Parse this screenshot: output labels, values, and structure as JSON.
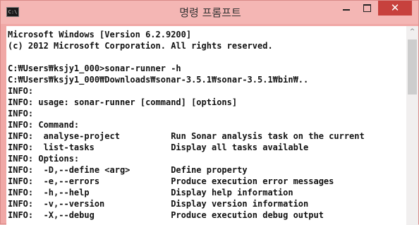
{
  "window": {
    "title": "명령 프롬프트",
    "icon_text": "C:\\",
    "close_glyph": "✕",
    "scroll_up_glyph": "^"
  },
  "console": {
    "lines": [
      "Microsoft Windows [Version 6.2.9200]",
      "(c) 2012 Microsoft Corporation. All rights reserved.",
      "",
      "C:₩Users₩ksjy1_000>sonar-runner -h",
      "C:₩Users₩ksjy1_000₩Downloads₩sonar-3.5.1₩sonar-3.5.1₩bin₩..",
      "INFO:",
      "INFO: usage: sonar-runner [command] [options]",
      "INFO:",
      "INFO: Command:",
      "INFO:  analyse-project          Run Sonar analysis task on the current",
      "INFO:  list-tasks               Display all tasks available",
      "INFO: Options:",
      "INFO:  -D,--define <arg>        Define property",
      "INFO:  -e,--errors              Produce execution error messages",
      "INFO:  -h,--help                Display help information",
      "INFO:  -v,--version             Display version information",
      "INFO:  -X,--debug               Produce execution debug output"
    ]
  }
}
